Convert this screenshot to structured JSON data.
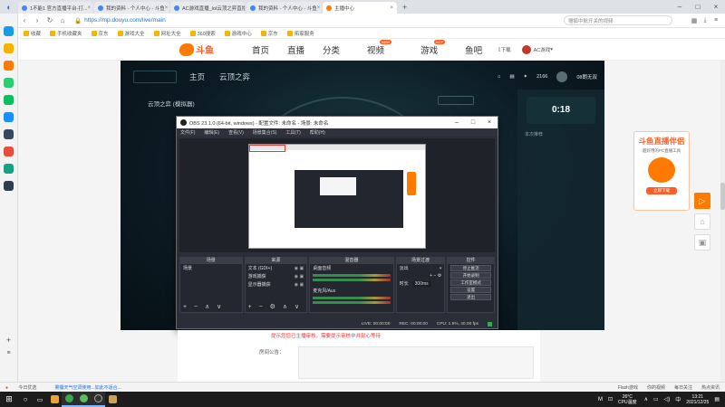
{
  "browser": {
    "tabs": [
      {
        "label": "1不能1 官方直播平台-打...",
        "active": false
      },
      {
        "label": "我的资料 - 个人中心 - 斗鱼",
        "active": false
      },
      {
        "label": "AC游戏直播_lol云顶之弈直播...",
        "active": false
      },
      {
        "label": "我的资料 - 个人中心 - 斗鱼",
        "active": false
      },
      {
        "label": "主播中心",
        "active": true
      }
    ],
    "url": "https://mp.douyu.com/live/main",
    "search_placeholder": "搜狐中航开关的视频",
    "bookmarks": [
      "收藏",
      "手机收藏夹",
      "京东",
      "游戏大全",
      "网址大全",
      "360搜索",
      "游戏中心",
      "京东",
      "拓家服务"
    ]
  },
  "douyu": {
    "logo_text": "斗鱼",
    "nav": [
      "首页",
      "直播",
      "分类",
      "视频",
      "游戏",
      "鱼吧"
    ],
    "nav_badges": {
      "video": "NEW",
      "game": "HOT"
    },
    "download": "下载",
    "username": "AC游戏"
  },
  "player": {
    "tabs": [
      "主页",
      "云顶之弈"
    ],
    "subtitle": "云顶之弈 (模拟器)",
    "stat_value": "2166",
    "stat_label": "08朗无双",
    "timer": "0:18",
    "side_label": "本次推荐"
  },
  "obs": {
    "title": "OBS 23.1.0 (64-bit, windows) - 配置文件: 未命名 - 场景: 未命名",
    "menu": [
      "文件(F)",
      "编辑(E)",
      "查看(V)",
      "场景集合(S)",
      "工具(T)",
      "帮助(H)"
    ],
    "docks": {
      "scenes": {
        "header": "场景",
        "items": [
          "场景"
        ]
      },
      "sources": {
        "header": "来源",
        "items": [
          "文本 (GDI+)",
          "游戏捕获",
          "显示器捕获"
        ]
      },
      "mixer": {
        "header": "混音器",
        "channels": [
          "桌面音频",
          "麦克风/Aux"
        ]
      },
      "transitions": {
        "header": "场景过渡",
        "type": "淡出",
        "duration_label": "时长",
        "duration": "300ms"
      },
      "controls": {
        "header": "控件",
        "buttons": [
          "停止推流",
          "开始录制",
          "工作室模式",
          "设置",
          "退出"
        ]
      }
    },
    "status": {
      "live": "LIVE: 00:00:00",
      "rec": "REC: 00:00:00",
      "cpu": "CPU: 1.9%, 40.00 fps"
    }
  },
  "ad": {
    "title": "斗鱼直播伴侣",
    "subtitle": "超好用的PC直播工具",
    "button": "立即下载"
  },
  "form": {
    "red_note": "提示您您已主播审核，需要提示审核中并耐心等待",
    "label": "房间公告："
  },
  "statusbar": {
    "left": [
      "今日优选",
      "雾霾天气空调使用...如此不适合..."
    ],
    "right": [
      "Flash游戏",
      "你的视频",
      "每日关注",
      "热点资讯"
    ]
  },
  "taskbar": {
    "weather_temp": "26°C",
    "weather_desc": "CPU温度",
    "time": "13:21",
    "date": "2021/12/25"
  },
  "colors": {
    "accent": "#ff5d23",
    "obs_bg": "#2b2e38"
  }
}
